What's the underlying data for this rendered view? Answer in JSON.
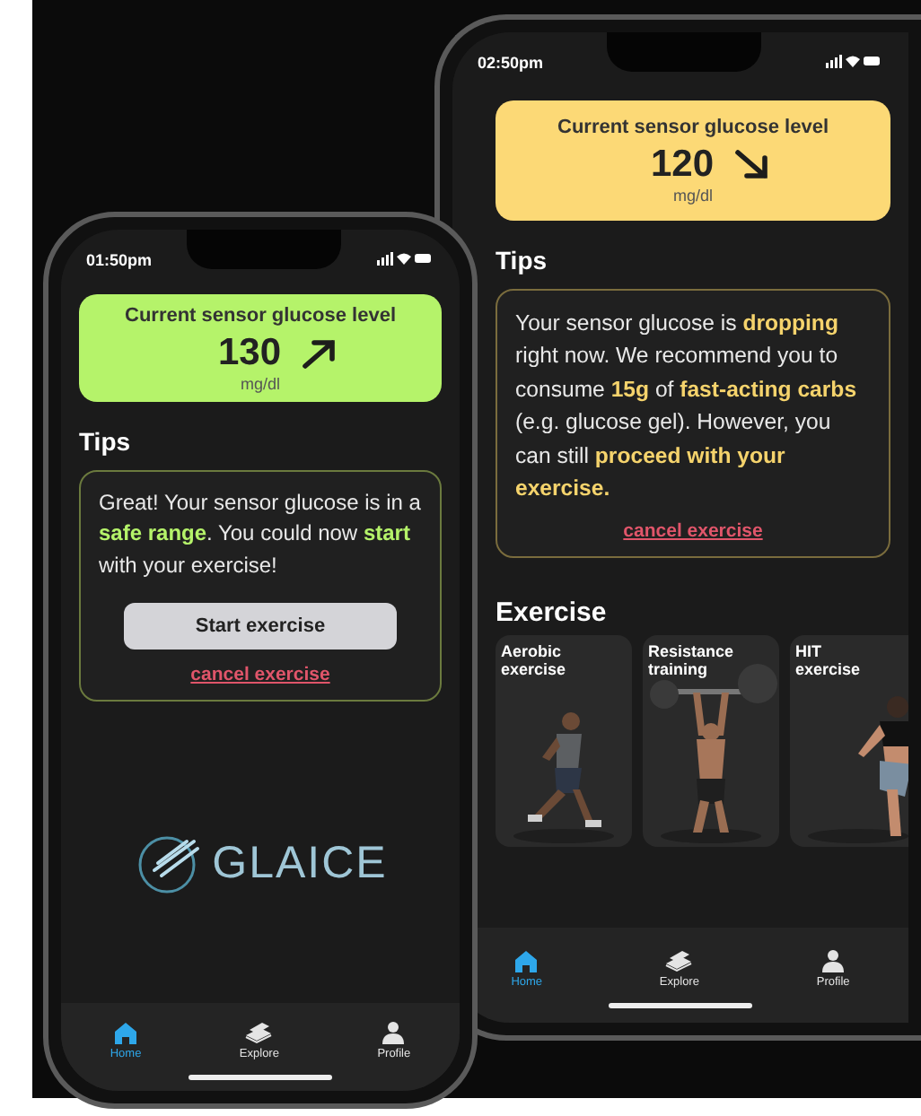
{
  "phones": [
    {
      "time": "01:50pm",
      "glucose": {
        "title": "Current sensor glucose level",
        "value": "130",
        "unit": "mg/dl",
        "kind": "rising",
        "color": "#b5f36a"
      },
      "tips": {
        "title": "Tips",
        "text": "Great! Your sensor glucose is in a **safe range**. You could now **start** with your exercise!",
        "button": "Start exercise",
        "cancel": "cancel exercise"
      },
      "logo": "GLAICE",
      "nav": [
        {
          "label": "Home",
          "selected": true
        },
        {
          "label": "Explore",
          "selected": false
        },
        {
          "label": "Profile",
          "selected": false
        }
      ]
    },
    {
      "time": "02:50pm",
      "glucose": {
        "title": "Current sensor glucose level",
        "value": "120",
        "unit": "mg/dl",
        "kind": "falling",
        "color": "#fcd976"
      },
      "tips": {
        "title": "Tips",
        "text": "Your sensor glucose is **dropping** right now. We recommend you to consume **15g** of **fast-acting carbs** (e.g. glucose gel). However, you can still **proceed with your exercise.**",
        "cancel": "cancel exercise"
      },
      "exercise": {
        "title": "Exercise",
        "cards": [
          {
            "label": "Aerobic exercise"
          },
          {
            "label": "Resistance training"
          },
          {
            "label": "HIT exercise"
          }
        ]
      },
      "nav": [
        {
          "label": "Home",
          "selected": true
        },
        {
          "label": "Explore",
          "selected": false
        },
        {
          "label": "Profile",
          "selected": false
        }
      ]
    }
  ]
}
